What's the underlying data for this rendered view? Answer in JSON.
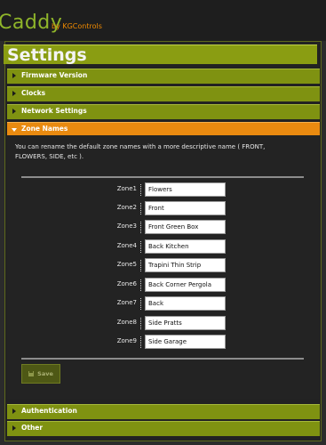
{
  "header": {
    "logo_text": "Caddy",
    "logo_by": "by KGControls"
  },
  "page": {
    "title": "Settings"
  },
  "sections": {
    "firmware": "Firmware Version",
    "clocks": "Clocks",
    "network": "Network Settings",
    "zone_names": "Zone Names",
    "authentication": "Authentication",
    "other": "Other"
  },
  "zone_names": {
    "description": "You can rename the default zone names with a more descriptive name ( FRONT, FLOWERS, SIDE, etc ).",
    "zones": [
      {
        "label": "Zone1",
        "value": "Flowers"
      },
      {
        "label": "Zone2",
        "value": "Front"
      },
      {
        "label": "Zone3",
        "value": "Front Green Box"
      },
      {
        "label": "Zone4",
        "value": "Back Kitchen"
      },
      {
        "label": "Zone5",
        "value": "Trapini Thin Strip"
      },
      {
        "label": "Zone6",
        "value": "Back Corner Pergola"
      },
      {
        "label": "Zone7",
        "value": "Back"
      },
      {
        "label": "Zone8",
        "value": "Side Pratts"
      },
      {
        "label": "Zone9",
        "value": "Side Garage"
      }
    ],
    "save_label": "Save"
  }
}
